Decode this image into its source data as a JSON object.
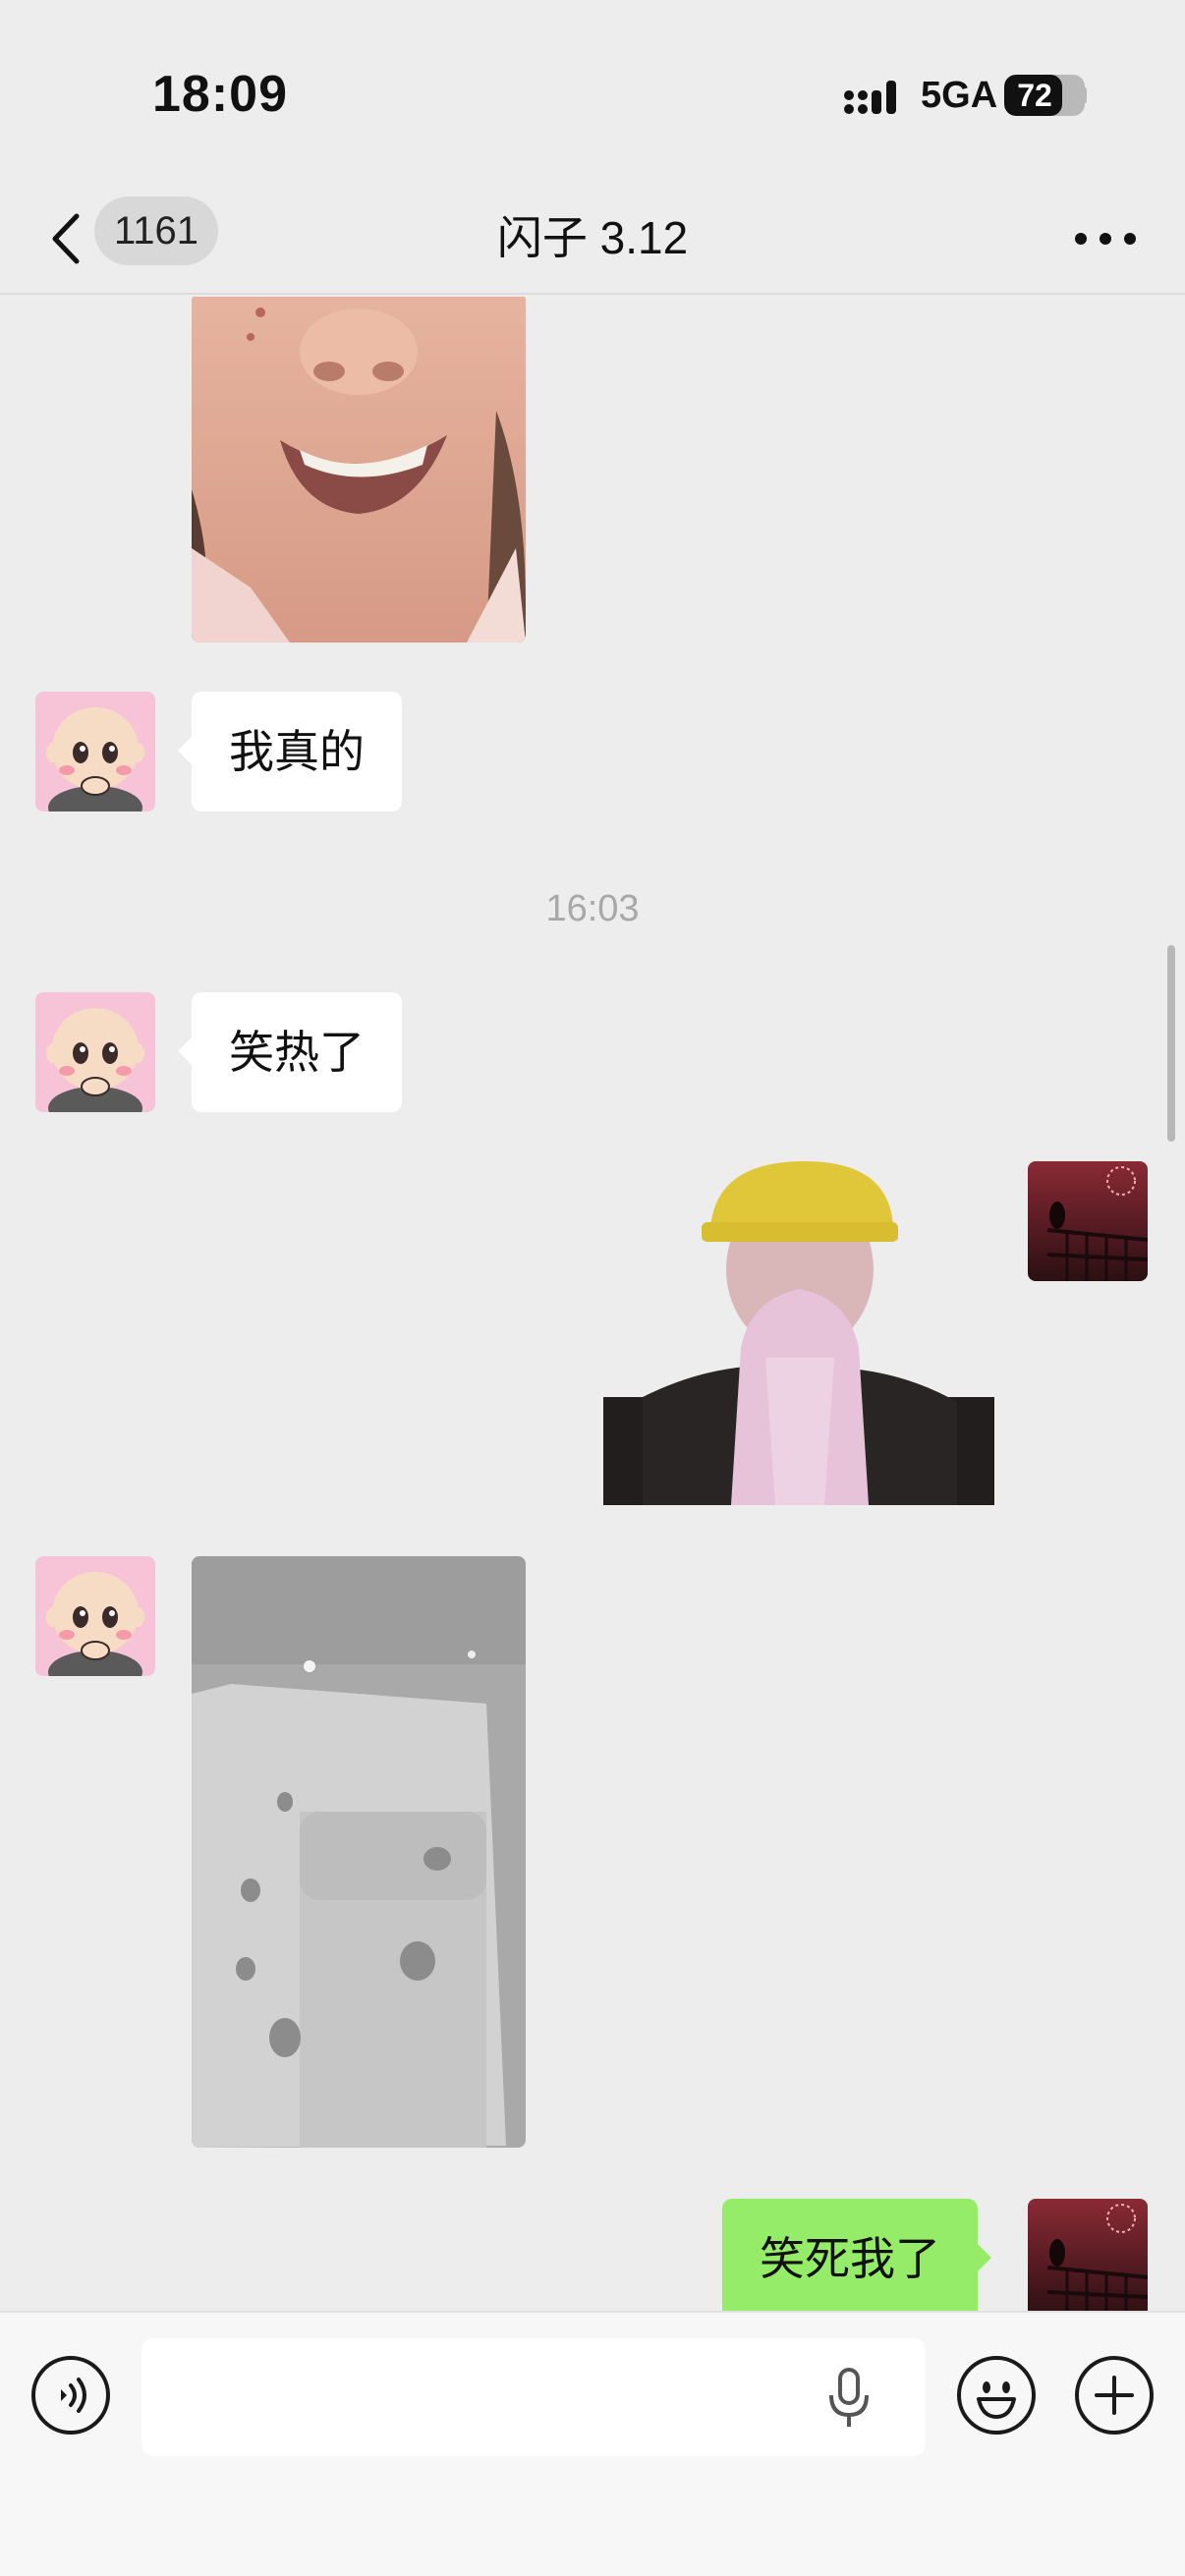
{
  "status_bar": {
    "time": "18:09",
    "network": "5GA",
    "battery": "72",
    "battery_level": 0.72
  },
  "nav": {
    "unread_count": "1161",
    "title": "闪子 3.12",
    "back_icon": "chevron-left-icon",
    "more_icon": "more-dots-icon"
  },
  "messages": [
    {
      "type": "image",
      "side": "in",
      "desc_icon": "photo-smiling-face"
    },
    {
      "type": "text",
      "side": "in",
      "text": "我真的"
    },
    {
      "type": "time",
      "text": "16:03"
    },
    {
      "type": "text",
      "side": "in",
      "text": "笑热了"
    },
    {
      "type": "sticker",
      "side": "out",
      "desc_icon": "sticker-clapping-person-yellow-hat"
    },
    {
      "type": "image",
      "side": "in",
      "desc_icon": "photo-paw-prints-on-paper"
    },
    {
      "type": "text",
      "side": "out",
      "text": "笑死我了"
    }
  ],
  "input_bar": {
    "voice_icon": "voice-mode-icon",
    "mic_icon": "microphone-icon",
    "emoji_icon": "emoji-icon",
    "add_icon": "plus-icon",
    "placeholder": ""
  },
  "colors": {
    "background": "#ededed",
    "bubble_in": "#ffffff",
    "bubble_out": "#95ec69"
  }
}
